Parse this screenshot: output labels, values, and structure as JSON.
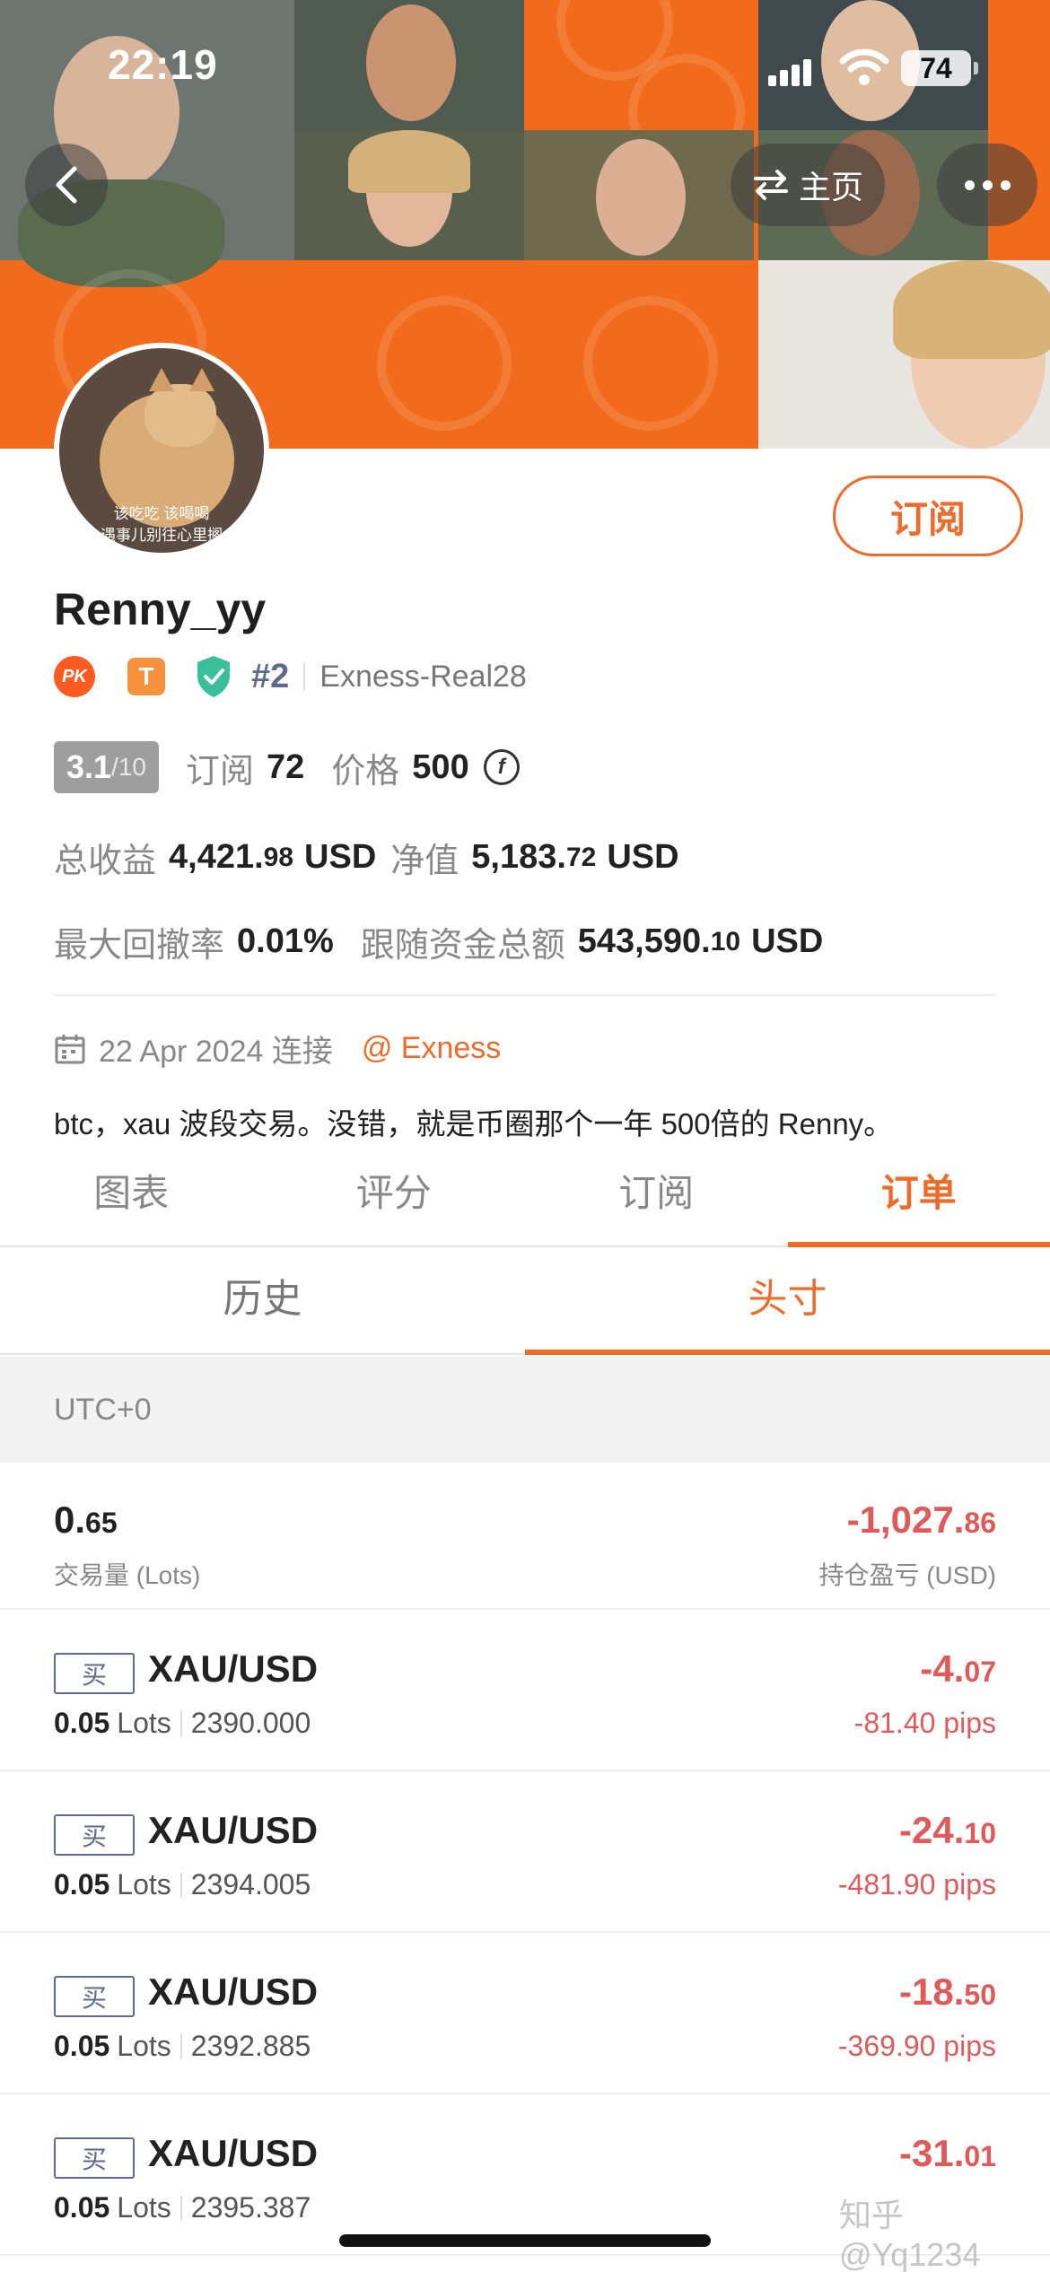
{
  "status_bar": {
    "time": "22:19",
    "battery": "74"
  },
  "nav": {
    "home_label": "主页"
  },
  "profile": {
    "avatar_caption_1": "该吃吃 该喝喝",
    "avatar_caption_2": "遇事儿别往心里搁",
    "subscribe_label": "订阅",
    "username": "Renny_yy",
    "badge_pk": "PK",
    "badge_t": "T",
    "rank": "#2",
    "broker_account": "Exness-Real28"
  },
  "stats": {
    "score_main": "3.1",
    "score_total": "/10",
    "subscriptions_label": "订阅",
    "subscriptions_value": "72",
    "price_label": "价格",
    "price_value": "500",
    "coin_icon_letter": "f",
    "total_profit_label": "总收益",
    "total_profit_int": "4,421.",
    "total_profit_dec": "98",
    "total_profit_unit": "USD",
    "equity_label": "净值",
    "equity_int": "5,183.",
    "equity_dec": "72",
    "equity_unit": "USD",
    "max_drawdown_label": "最大回撤率",
    "max_drawdown_value": "0.01%",
    "follow_funds_label": "跟随资金总额",
    "follow_funds_int": "543,590.",
    "follow_funds_dec": "10",
    "follow_funds_unit": "USD"
  },
  "info": {
    "join_date": "22 Apr 2024 连接",
    "broker_link": "@ Exness",
    "bio": "btc，xau 波段交易。没错，就是币圈那个一年 500倍的 Renny。"
  },
  "tabs": [
    "图表",
    "评分",
    "订阅",
    "订单"
  ],
  "active_tab": "订单",
  "subtabs": [
    "历史",
    "头寸"
  ],
  "active_subtab": "头寸",
  "timezone": "UTC+0",
  "summary": {
    "volume_int": "0.",
    "volume_dec": "65",
    "volume_label": "交易量 (Lots)",
    "pnl_int": "-1,027.",
    "pnl_dec": "86",
    "pnl_label": "持仓盈亏 (USD)"
  },
  "orders": [
    {
      "side": "买",
      "symbol": "XAU/USD",
      "lots": "0.05",
      "lots_unit": "Lots",
      "price": "2390.000",
      "pnl_int": "-4.",
      "pnl_dec": "07",
      "pips": "-81.40 pips"
    },
    {
      "side": "买",
      "symbol": "XAU/USD",
      "lots": "0.05",
      "lots_unit": "Lots",
      "price": "2394.005",
      "pnl_int": "-24.",
      "pnl_dec": "10",
      "pips": "-481.90 pips"
    },
    {
      "side": "买",
      "symbol": "XAU/USD",
      "lots": "0.05",
      "lots_unit": "Lots",
      "price": "2392.885",
      "pnl_int": "-18.",
      "pnl_dec": "50",
      "pips": "-369.90 pips"
    },
    {
      "side": "买",
      "symbol": "XAU/USD",
      "lots": "0.05",
      "lots_unit": "Lots",
      "price": "2395.387",
      "pnl_int": "-31.",
      "pnl_dec": "01",
      "pips": ""
    }
  ],
  "watermark": "知乎 @Yq1234",
  "colors": {
    "accent": "#f06b2a",
    "negative": "#e05a5a",
    "banner": "#f26a1b"
  },
  "icons": [
    "back-arrow-icon",
    "swap-icon",
    "more-icon",
    "shield-check-icon",
    "calendar-icon",
    "coin-icon",
    "signal-icon",
    "wifi-icon",
    "battery-icon"
  ]
}
